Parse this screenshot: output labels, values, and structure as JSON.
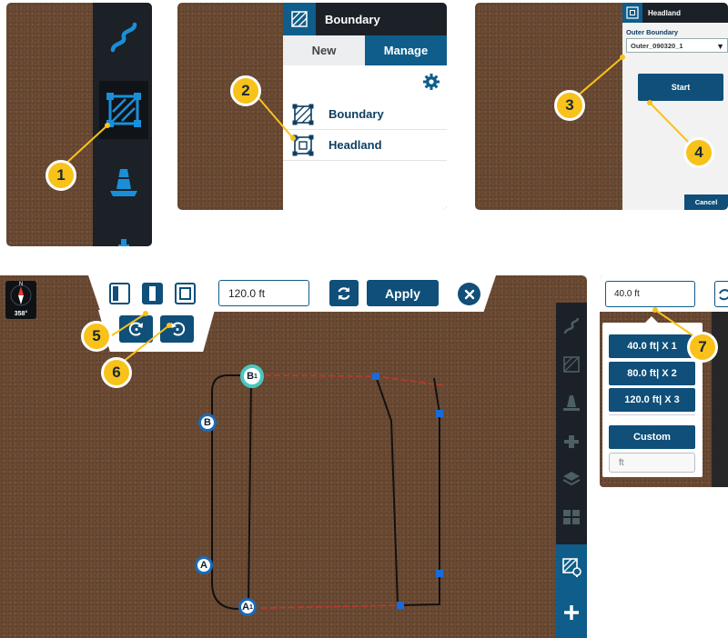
{
  "callouts": [
    "1",
    "2",
    "3",
    "4",
    "5",
    "6",
    "7"
  ],
  "boundary_menu": {
    "title": "Boundary",
    "tabs": {
      "new": "New",
      "manage": "Manage"
    },
    "items": [
      "Boundary",
      "Headland"
    ]
  },
  "headland_dialog": {
    "title": "Headland",
    "outer_boundary_label": "Outer Boundary",
    "outer_boundary_value": "Outer_090320_1",
    "start_label": "Start",
    "cancel_label": "Cancel"
  },
  "main_map": {
    "compass_letter": "N",
    "heading": "358°",
    "width_value": "120.0 ft",
    "apply_label": "Apply",
    "point_labels": {
      "a": "A",
      "b": "B",
      "a1": "A",
      "b1": "B",
      "sup": "1"
    }
  },
  "width_popup": {
    "field_value": "40.0 ft",
    "options": [
      "40.0 ft| X 1",
      "80.0 ft| X 2",
      "120.0 ft| X 3"
    ],
    "custom_label": "Custom",
    "custom_unit": "ft"
  },
  "colors": {
    "primary_blue": "#0f4f79",
    "accent_blue": "#1a8fd8",
    "callout_yellow": "#f8c21b",
    "field_brown": "#6b4a33",
    "sidebar_dark": "#1b2127"
  }
}
